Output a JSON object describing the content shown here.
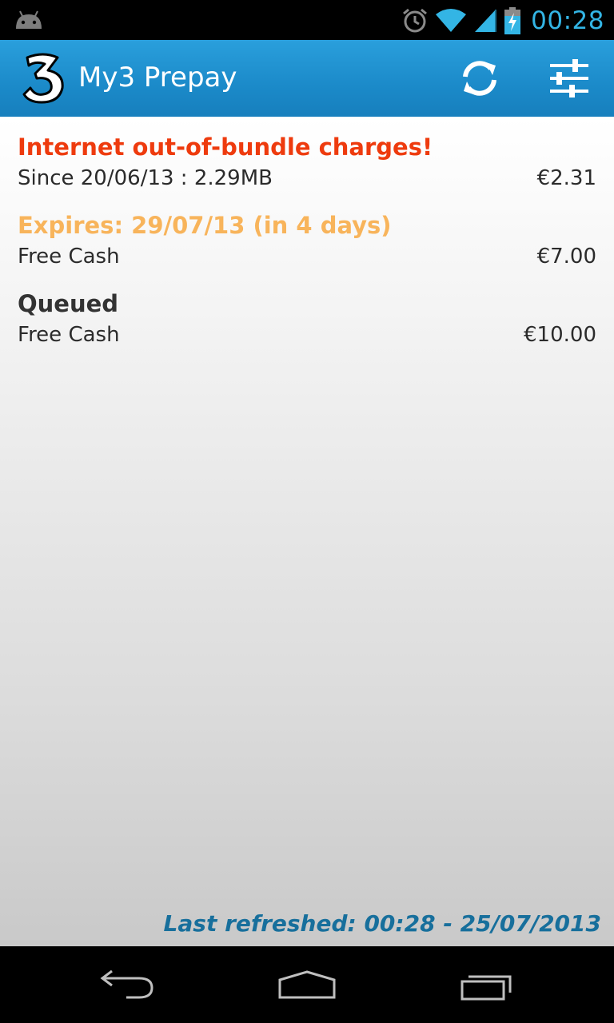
{
  "status_bar": {
    "time": "00:28",
    "icons": [
      "android-icon",
      "alarm-icon",
      "wifi-icon",
      "signal-icon",
      "battery-charging-icon"
    ]
  },
  "action_bar": {
    "title": "My3 Prepay",
    "logo": "three-logo",
    "actions": [
      "refresh-icon",
      "settings-sliders-icon"
    ]
  },
  "sections": {
    "charges": {
      "heading": "Internet out-of-bundle charges!",
      "heading_color": "#ee3b0e",
      "row_label": "Since 20/06/13 : 2.29MB",
      "row_value": "€2.31"
    },
    "expires": {
      "heading": "Expires: 29/07/13 (in 4 days)",
      "heading_color": "#f8b45b",
      "row_label": "Free Cash",
      "row_value": "€7.00"
    },
    "queued": {
      "heading": "Queued",
      "heading_color": "#333333",
      "row_label": "Free Cash",
      "row_value": "€10.00"
    }
  },
  "footer": {
    "last_refreshed": "Last refreshed: 00:28  -  25/07/2013"
  },
  "nav_bar": {
    "buttons": [
      "back-icon",
      "home-icon",
      "recent-apps-icon"
    ]
  }
}
